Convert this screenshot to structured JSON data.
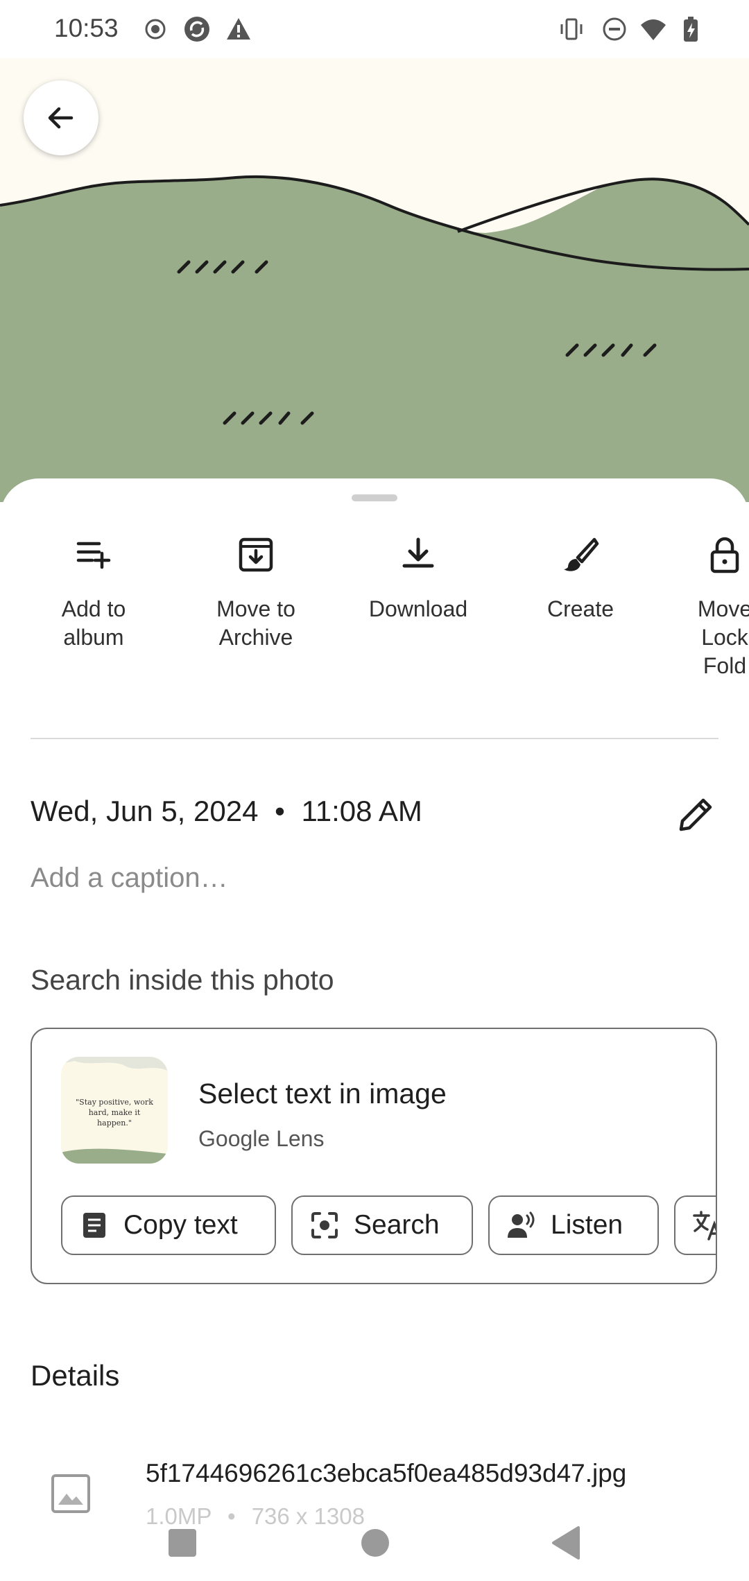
{
  "status_bar": {
    "time": "10:53",
    "left_icons": [
      "record-icon",
      "sync-icon",
      "warning-icon"
    ],
    "right_icons": [
      "vibrate-icon",
      "do-not-disturb-icon",
      "wifi-icon",
      "battery-charging-icon"
    ]
  },
  "photo": {
    "back_icon": "arrow-back-icon",
    "sky_color": "#fdfbf2",
    "hill_color": "#9aad8a"
  },
  "actions": [
    {
      "label": "Add to\nalbum",
      "icon": "playlist-add-icon"
    },
    {
      "label": "Move to\nArchive",
      "icon": "archive-icon"
    },
    {
      "label": "Download",
      "icon": "download-icon"
    },
    {
      "label": "Create",
      "icon": "brush-icon"
    },
    {
      "label": "Move\nLock\nFold",
      "icon": "lock-icon"
    }
  ],
  "info": {
    "date": "Wed, Jun 5, 2024",
    "separator": "•",
    "time": "11:08 AM",
    "caption_placeholder": "Add a caption…"
  },
  "search_section": {
    "title": "Search inside this photo",
    "card_title": "Select text in image",
    "card_subtitle": "Google Lens",
    "thumbnail_text": "\"Stay positive, work hard, make it happen.\"",
    "chips": [
      {
        "label": "Copy text",
        "icon": "document-text-icon"
      },
      {
        "label": "Search",
        "icon": "lens-search-icon"
      },
      {
        "label": "Listen",
        "icon": "speaker-person-icon"
      },
      {
        "label": "",
        "icon": "translate-icon"
      }
    ]
  },
  "details": {
    "title": "Details",
    "file_name": "5f1744696261c3ebca5f0ea485d93d47.jpg",
    "megapixels": "1.0MP",
    "dot": "•",
    "resolution": "736 x 1308"
  },
  "nav_bar": {
    "icons": [
      "recents-square-icon",
      "home-circle-icon",
      "back-triangle-icon"
    ]
  }
}
